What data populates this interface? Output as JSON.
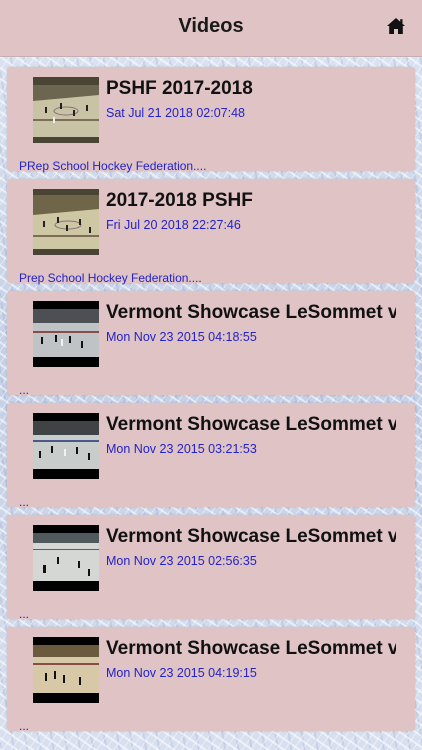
{
  "header": {
    "title": "Videos",
    "home_icon": "home-icon"
  },
  "videos": [
    {
      "title": "PSHF 2017-2018",
      "date": "Sat Jul 21 2018 02:07:48",
      "description": "PRep School Hockey Federation....",
      "thumbnail": "ice-hockey-rink-frame-wide"
    },
    {
      "title": "2017-2018 PSHF",
      "date": "Fri Jul 20 2018 22:27:46",
      "description": "Prep School Hockey Federation....",
      "thumbnail": "ice-hockey-rink-frame-wide"
    },
    {
      "title": "Vermont Showcase LeSommet v",
      "date": "Mon Nov 23 2015 04:18:55",
      "description": "...",
      "thumbnail": "ice-hockey-rink-frame-letterbox"
    },
    {
      "title": "Vermont Showcase LeSommet v",
      "date": "Mon Nov 23 2015 03:21:53",
      "description": "...",
      "thumbnail": "ice-hockey-rink-frame-letterbox"
    },
    {
      "title": "Vermont Showcase LeSommet v",
      "date": "Mon Nov 23 2015 02:56:35",
      "description": "...",
      "thumbnail": "ice-hockey-rink-frame-letterbox"
    },
    {
      "title": "Vermont Showcase LeSommet v",
      "date": "Mon Nov 23 2015 04:19:15",
      "description": "...",
      "thumbnail": "ice-hockey-rink-frame-letterbox"
    }
  ],
  "colors": {
    "card_background": "#dfc3c5",
    "date_text": "#2323c8",
    "title_text": "#111111"
  }
}
